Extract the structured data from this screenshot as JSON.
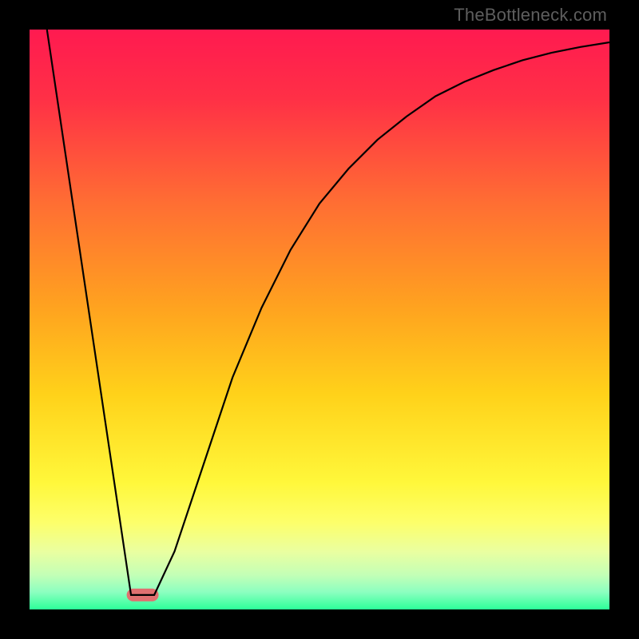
{
  "watermark": "TheBottleneck.com",
  "chart_data": {
    "type": "line",
    "title": "",
    "xlabel": "",
    "ylabel": "",
    "xlim": [
      0,
      100
    ],
    "ylim": [
      0,
      100
    ],
    "gradient_stops": [
      {
        "pos": 0.0,
        "color": "#ff1a50"
      },
      {
        "pos": 0.12,
        "color": "#ff3046"
      },
      {
        "pos": 0.3,
        "color": "#ff6e33"
      },
      {
        "pos": 0.48,
        "color": "#ffa31f"
      },
      {
        "pos": 0.63,
        "color": "#ffd21a"
      },
      {
        "pos": 0.78,
        "color": "#fff73a"
      },
      {
        "pos": 0.85,
        "color": "#fdff6a"
      },
      {
        "pos": 0.9,
        "color": "#eaffa0"
      },
      {
        "pos": 0.94,
        "color": "#c4ffb6"
      },
      {
        "pos": 0.97,
        "color": "#8cffc0"
      },
      {
        "pos": 1.0,
        "color": "#2cff99"
      }
    ],
    "series": [
      {
        "name": "curve",
        "color": "#000000",
        "points_xy": [
          [
            3,
            100
          ],
          [
            17.5,
            2.5
          ],
          [
            21.5,
            2.5
          ],
          [
            25,
            10
          ],
          [
            30,
            25
          ],
          [
            35,
            40
          ],
          [
            40,
            52
          ],
          [
            45,
            62
          ],
          [
            50,
            70
          ],
          [
            55,
            76
          ],
          [
            60,
            81
          ],
          [
            65,
            85
          ],
          [
            70,
            88.5
          ],
          [
            75,
            91
          ],
          [
            80,
            93
          ],
          [
            85,
            94.7
          ],
          [
            90,
            96
          ],
          [
            95,
            97
          ],
          [
            100,
            97.8
          ]
        ]
      }
    ],
    "marker": {
      "x": 19.5,
      "y": 2.5,
      "width": 5.5,
      "height": 2.2,
      "color": "#e07070"
    }
  }
}
